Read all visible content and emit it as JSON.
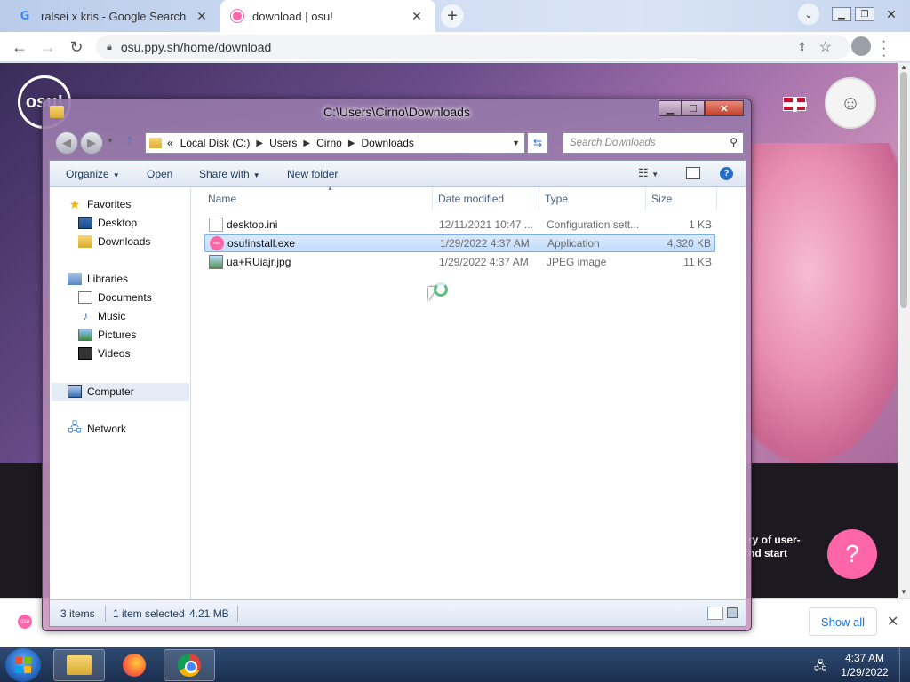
{
  "browser": {
    "tabs": [
      {
        "title": "ralsei x kris - Google Search",
        "icon": "google-icon",
        "active": false
      },
      {
        "title": "download | osu!",
        "icon": "osu-favicon",
        "active": true
      }
    ],
    "url": "osu.ppy.sh/home/download"
  },
  "page": {
    "logo_text": "osu!",
    "text_line1": "ry of user-",
    "text_line2": "nd start",
    "help_label": "?"
  },
  "download_bar": {
    "show_all_label": "Show all"
  },
  "explorer": {
    "title": "C:\\Users\\Cirno\\Downloads",
    "breadcrumb": [
      "Local Disk (C:)",
      "Users",
      "Cirno",
      "Downloads"
    ],
    "breadcrumb_overflow": "«",
    "search_placeholder": "Search Downloads",
    "commands": {
      "organize": "Organize",
      "open": "Open",
      "share_with": "Share with",
      "new_folder": "New folder"
    },
    "nav": {
      "favorites": "Favorites",
      "desktop": "Desktop",
      "downloads": "Downloads",
      "libraries": "Libraries",
      "documents": "Documents",
      "music": "Music",
      "pictures": "Pictures",
      "videos": "Videos",
      "computer": "Computer",
      "network": "Network"
    },
    "columns": {
      "name": "Name",
      "date": "Date modified",
      "type": "Type",
      "size": "Size"
    },
    "files": [
      {
        "name": "desktop.ini",
        "date": "12/11/2021 10:47 ...",
        "type": "Configuration sett...",
        "size": "1 KB",
        "selected": false
      },
      {
        "name": "osu!install.exe",
        "date": "1/29/2022 4:37 AM",
        "type": "Application",
        "size": "4,320 KB",
        "selected": true
      },
      {
        "name": "ua+RUiajr.jpg",
        "date": "1/29/2022 4:37 AM",
        "type": "JPEG image",
        "size": "11 KB",
        "selected": false
      }
    ],
    "status": {
      "items": "3 items",
      "selected": "1 item selected",
      "selected_size": "4.21 MB"
    }
  },
  "taskbar": {
    "time": "4:37 AM",
    "date": "1/29/2022"
  },
  "colors": {
    "osu_pink": "#ff66aa",
    "selection": "#c1dcfb",
    "taskbar": "#1b2f4f"
  }
}
